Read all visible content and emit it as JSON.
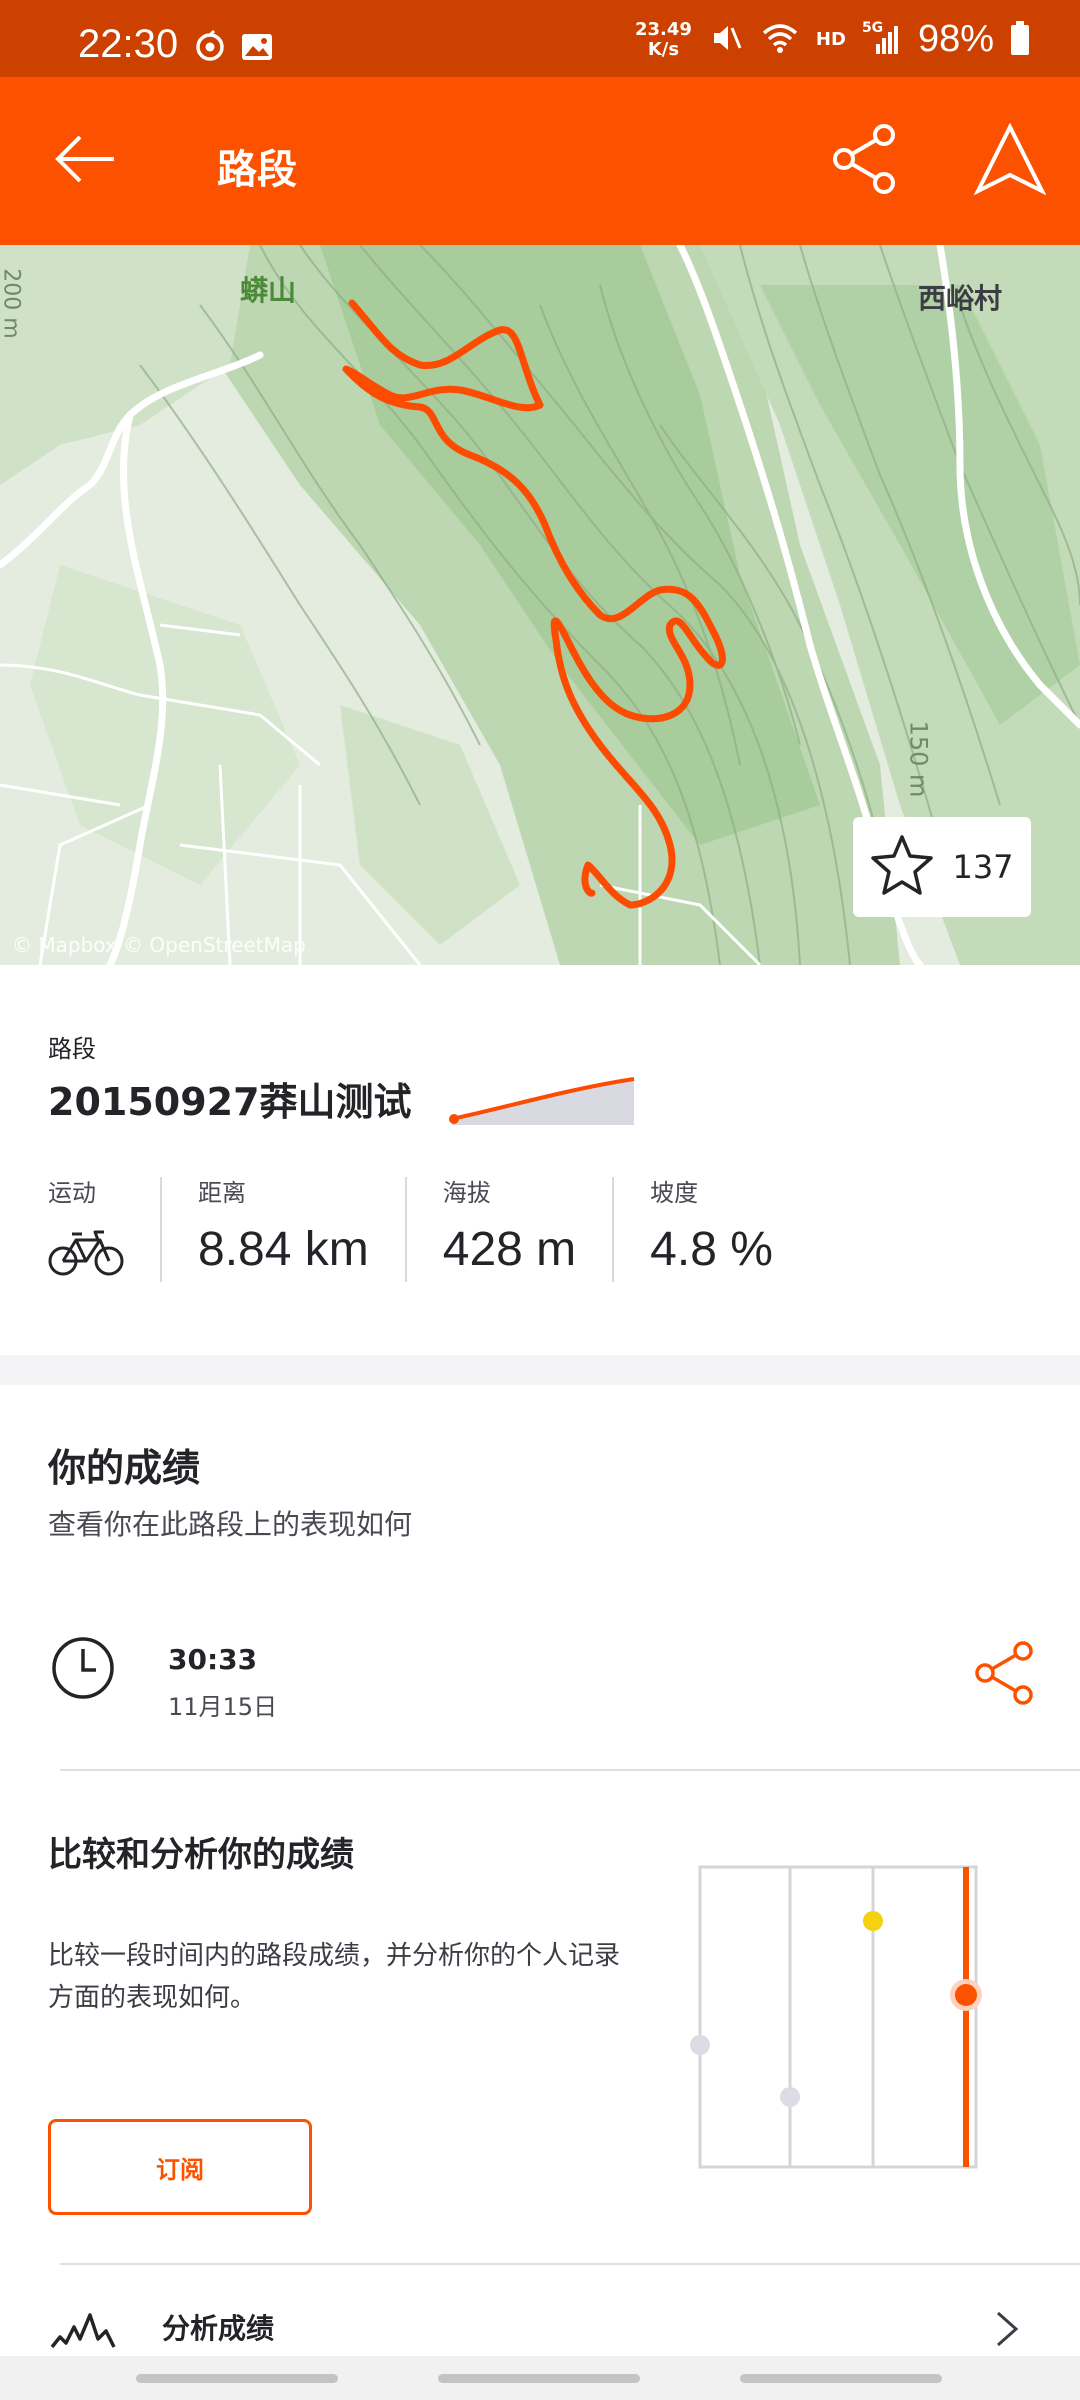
{
  "status_bar": {
    "time": "22:30",
    "net_speed_value": "23.49",
    "net_speed_unit": "K/s",
    "hd_label": "HD",
    "network": "5G",
    "battery": "98%"
  },
  "app_bar": {
    "title": "路段",
    "icons": [
      "back-arrow-icon",
      "share-icon",
      "navigate-icon"
    ]
  },
  "map": {
    "labels": {
      "mountain": "蟒山",
      "village": "西峪村",
      "contour_left": "200 m",
      "contour_right": "150 m"
    },
    "attribution": "© Mapbox © OpenStreetMap",
    "star_count": "137",
    "route_color": "#fc4c02"
  },
  "segment": {
    "label": "路段",
    "name": "20150927莽山测试",
    "stats": [
      {
        "label": "运动",
        "icon": "bike-icon"
      },
      {
        "label": "距离",
        "value": "8.84 km"
      },
      {
        "label": "海拔",
        "value": "428 m"
      },
      {
        "label": "坡度",
        "value": "4.8 %"
      }
    ]
  },
  "performance": {
    "title": "你的成绩",
    "subtitle": "查看你在此路段上的表现如何",
    "effort": {
      "time": "30:33",
      "date": "11月15日"
    },
    "compare": {
      "title": "比较和分析你的成绩",
      "description": "比较一段时间内的路段成绩，并分析你的个人记录方面的表现如何。",
      "button": "订阅"
    },
    "analyze": {
      "title": "分析成绩"
    }
  },
  "colors": {
    "brand": "#fc5200",
    "status_bar": "#cc4100",
    "gold": "#f5d10f"
  }
}
